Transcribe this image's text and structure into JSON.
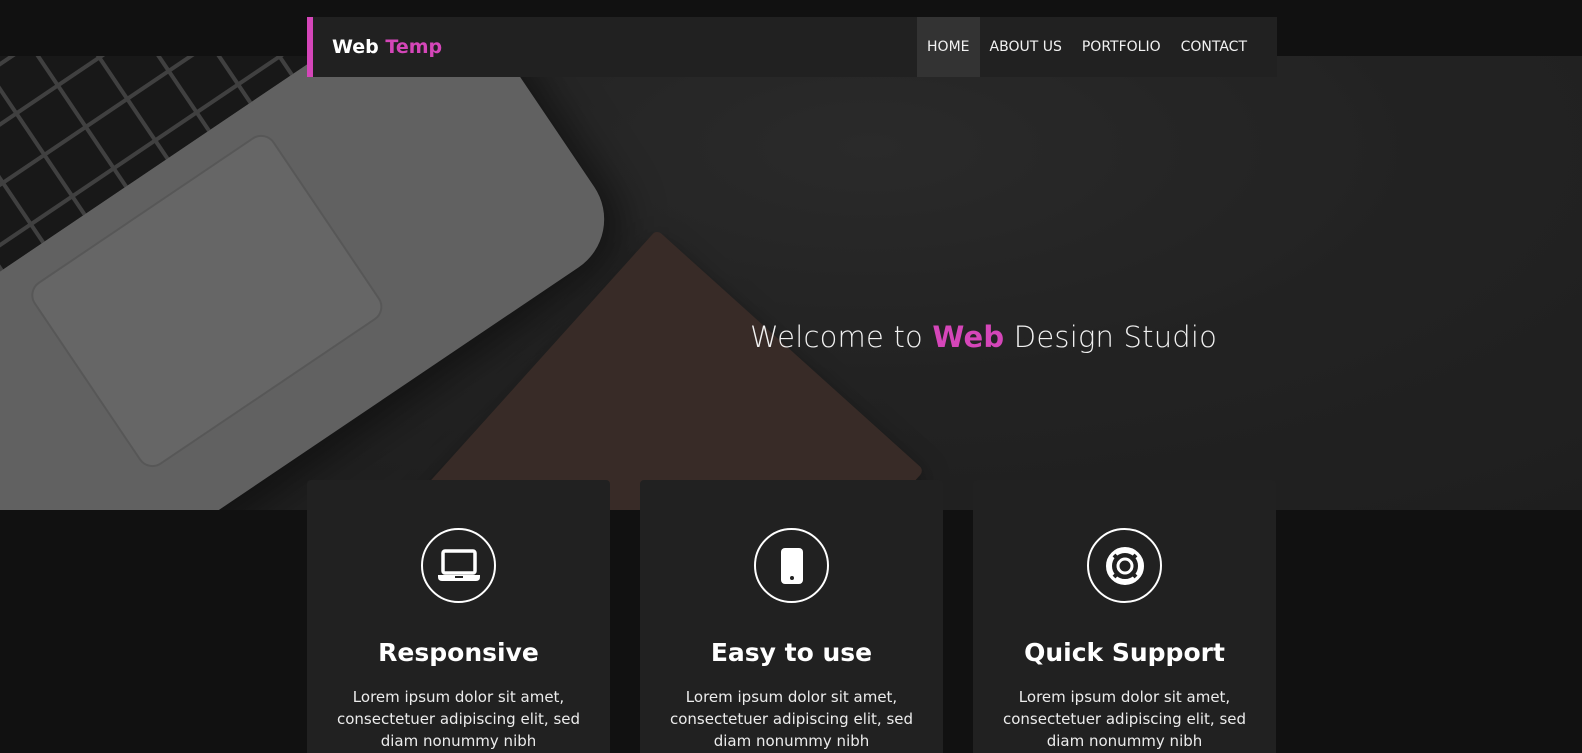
{
  "brand": {
    "part1": "Web",
    "part2": "Temp"
  },
  "nav": {
    "items": [
      {
        "label": "HOME",
        "active": true
      },
      {
        "label": "ABOUT US",
        "active": false
      },
      {
        "label": "PORTFOLIO",
        "active": false
      },
      {
        "label": "CONTACT",
        "active": false
      }
    ]
  },
  "hero": {
    "title_prefix": "Welcome to ",
    "title_accent": "Web",
    "title_suffix": " Design Studio"
  },
  "features": [
    {
      "icon": "laptop-icon",
      "title": "Responsive",
      "text": "Lorem ipsum dolor sit amet, consectetuer adipiscing elit, sed diam nonummy nibh"
    },
    {
      "icon": "mobile-icon",
      "title": "Easy to use",
      "text": "Lorem ipsum dolor sit amet, consectetuer adipiscing elit, sed diam nonummy nibh"
    },
    {
      "icon": "life-ring-icon",
      "title": "Quick Support",
      "text": "Lorem ipsum dolor sit amet, consectetuer adipiscing elit, sed diam nonummy nibh"
    }
  ],
  "colors": {
    "accent": "#d546b9",
    "background": "#111111",
    "card": "#212121",
    "navbar": "#212121"
  }
}
